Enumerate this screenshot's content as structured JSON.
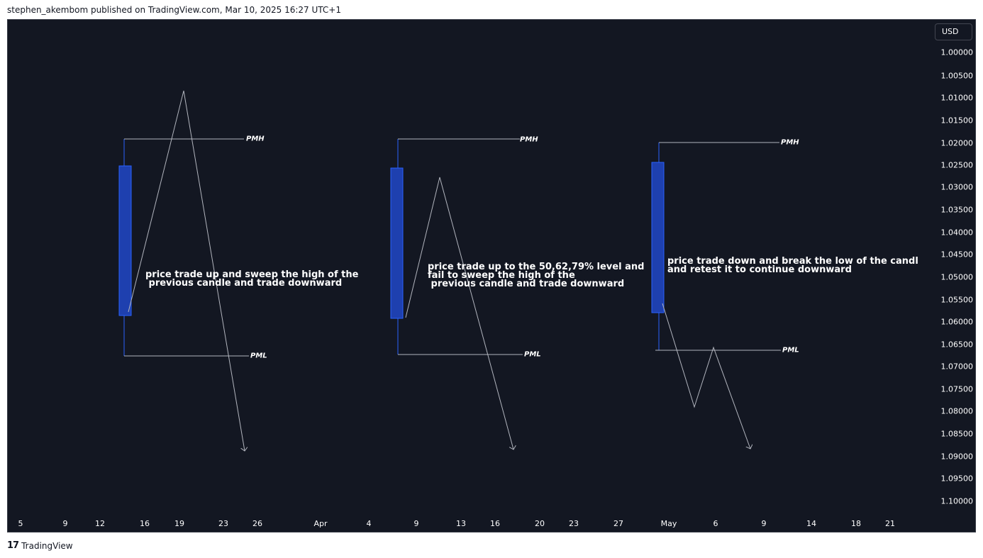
{
  "header": {
    "publish_line": "stephen_akembom published on TradingView.com, Mar 10, 2025 16:27 UTC+1"
  },
  "price_scale": {
    "currency": "USD",
    "labels": [
      "1.00000",
      "1.00500",
      "1.01000",
      "1.01500",
      "1.02000",
      "1.02500",
      "1.03000",
      "1.03500",
      "1.04000",
      "1.04500",
      "1.05000",
      "1.05500",
      "1.06000",
      "1.06500",
      "1.07000",
      "1.07500",
      "1.08000",
      "1.08500",
      "1.09000",
      "1.09500",
      "1.10000"
    ]
  },
  "time_axis": {
    "labels": [
      "5",
      "9",
      "12",
      "16",
      "19",
      "23",
      "26",
      "Apr",
      "4",
      "9",
      "13",
      "16",
      "20",
      "23",
      "27",
      "May",
      "6",
      "9",
      "14",
      "18",
      "21"
    ]
  },
  "annotations": {
    "first": "price trade up and sweep the high of the\n previous candle and trade downward",
    "second": "price trade up to the 50,62,79% level and\nfail to sweep the high of the\n previous candle and trade downward",
    "third": "price trade down and break the low of the candle\nand retest it to continue downward"
  },
  "levels": {
    "pmh": "PMH",
    "pml": "PML"
  },
  "colors": {
    "background": "#131722",
    "candle": "#2962ff",
    "candle_fill": "#1e40af",
    "line": "#b2b5be"
  },
  "footer": {
    "brand": "TradingView",
    "logo_glyph": "17"
  }
}
